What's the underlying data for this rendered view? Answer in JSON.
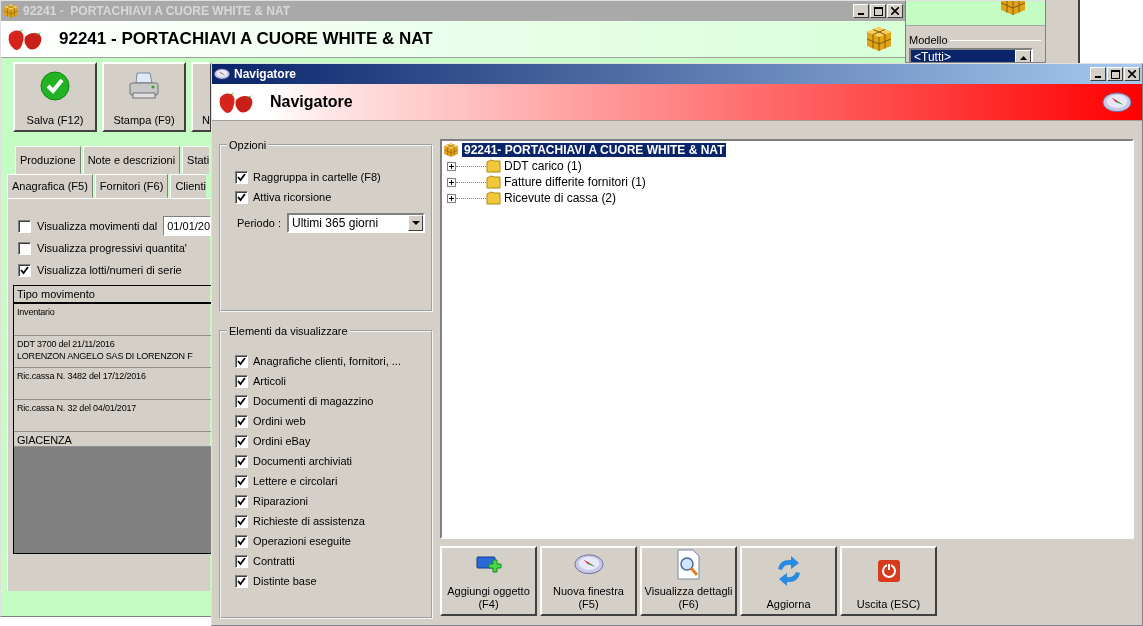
{
  "main_window": {
    "title": "92241 -  PORTACHIAVI A CUORE WHITE & NAT",
    "heading": "92241 - PORTACHIAVI A CUORE WHITE & NAT",
    "toolbar": [
      {
        "label": "Salva (F12)"
      },
      {
        "label": "Stampa (F9)"
      },
      {
        "label": "N"
      }
    ],
    "tabs_row_1": [
      {
        "label": "Produzione",
        "selected": false
      },
      {
        "label": "Note e descrizioni",
        "selected": false
      },
      {
        "label": "Stati",
        "selected": false
      }
    ],
    "tabs_row_2": [
      {
        "label": "Anagrafica (F5)",
        "selected": false
      },
      {
        "label": "Fornitori (F6)",
        "selected": false
      },
      {
        "label": "Clienti",
        "selected": false
      }
    ],
    "options": [
      {
        "label": "Visualizza movimenti dal",
        "checked": false,
        "date": "01/01/20"
      },
      {
        "label": "Visualizza progressivi quantita'",
        "checked": false
      },
      {
        "label": "Visualizza lotti/numeri di serie",
        "checked": true
      }
    ],
    "table": {
      "columns": [
        "Tipo movimento"
      ],
      "rows": [
        {
          "kind": "movement",
          "text": "Inventario"
        },
        {
          "kind": "movement",
          "text": "DDT 3700 del 21/11/2016\nLORENZON ANGELO SAS DI LORENZON F"
        },
        {
          "kind": "movement",
          "text": "Ric.cassa N. 3482 del 17/12/2016"
        },
        {
          "kind": "movement",
          "text": "Ric.cassa N. 32 del 04/01/2017"
        },
        {
          "kind": "total",
          "text": "GIACENZA"
        }
      ]
    }
  },
  "side_window": {
    "group_title": "Modello",
    "list": [
      {
        "label": "<Tutti>",
        "selected": true
      }
    ]
  },
  "navigator": {
    "title": "Navigatore",
    "heading": "Navigatore",
    "options": {
      "title": "Opzioni",
      "checkboxes": [
        {
          "label": "Raggruppa in cartelle (F8)",
          "checked": true
        },
        {
          "label": "Attiva ricorsione",
          "checked": true
        }
      ],
      "period_label": "Periodo :",
      "period_value": "Ultimi 365 giorni"
    },
    "elements": {
      "title": "Elementi da visualizzare",
      "checkboxes": [
        {
          "label": "Anagrafiche clienti, fornitori, ...",
          "checked": true
        },
        {
          "label": "Articoli",
          "checked": true
        },
        {
          "label": "Documenti di magazzino",
          "checked": true
        },
        {
          "label": "Ordini web",
          "checked": true
        },
        {
          "label": "Ordini eBay",
          "checked": true
        },
        {
          "label": "Documenti archiviati",
          "checked": true
        },
        {
          "label": "Lettere e circolari",
          "checked": true
        },
        {
          "label": "Riparazioni",
          "checked": true
        },
        {
          "label": "Richieste di assistenza",
          "checked": true
        },
        {
          "label": "Operazioni eseguite",
          "checked": true
        },
        {
          "label": "Contratti",
          "checked": true
        },
        {
          "label": "Distinte base",
          "checked": true
        }
      ]
    },
    "tree": {
      "root": {
        "label": "92241- PORTACHIAVI A CUORE WHITE & NAT",
        "selected": true,
        "children": [
          {
            "label": "DDT carico (1)",
            "expanded": false
          },
          {
            "label": "Fatture differite fornitori (1)",
            "expanded": false
          },
          {
            "label": "Ricevute di cassa (2)",
            "expanded": false
          }
        ]
      }
    },
    "buttons": [
      {
        "label": "Aggiungi oggetto\n(F4)"
      },
      {
        "label": "Nuova finestra\n(F5)"
      },
      {
        "label": "Visualizza dettagli\n(F6)"
      },
      {
        "label": "Aggiorna"
      },
      {
        "label": "Uscita (ESC)"
      }
    ]
  }
}
